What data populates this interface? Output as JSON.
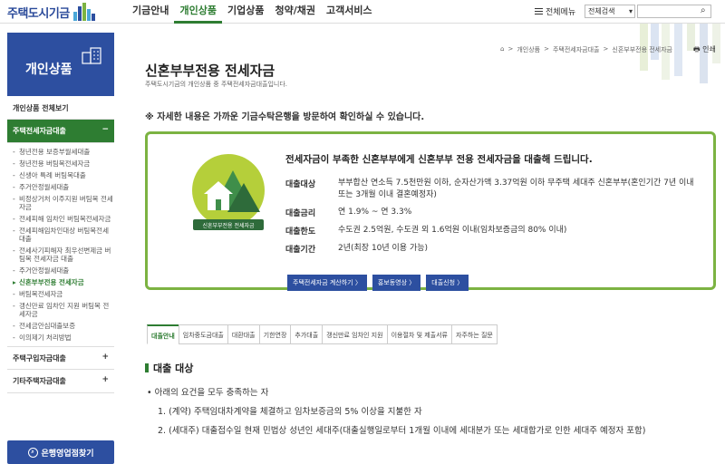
{
  "header": {
    "logo_text": "주택도시기금",
    "nav": [
      "기금안내",
      "개인상품",
      "기업상품",
      "청약/채권",
      "고객서비스"
    ],
    "sitemap_label": "전체메뉴",
    "search_select": "전체검색",
    "search_placeholder": ""
  },
  "sidebar": {
    "hero_title": "개인상품",
    "all_label": "개인상품 전체보기",
    "groups": [
      {
        "label": "주택전세자금대출",
        "toggle": "−"
      },
      {
        "label": "주택구입자금대출",
        "toggle": "+"
      },
      {
        "label": "기타주택자금대출",
        "toggle": "+"
      }
    ],
    "sub_items": [
      "청년전용 보증부월세대출",
      "청년전용 버팀목전세자금",
      "신생아 특례 버팀목대출",
      "주거안정월세대출",
      "비정상거처 이주지원 버팀목 전세자금",
      "전세피해 임차인 버팀목전세자금",
      "전세피해임차인대상 버팀목전세대출",
      "전세사기피해자 최우선변제금 버팀목 전세자금 대출",
      "주거안정월세대출",
      "신혼부부전용 전세자금",
      "버팀목전세자금",
      "갱신만료 임차인 지원 버팀목 전세자금",
      "전세금안심대출보증",
      "이의제기 처리방법"
    ],
    "bank_button": "은행영업점찾기"
  },
  "content": {
    "breadcrumb": [
      "⌂",
      ">",
      "개인상품",
      ">",
      "주택전세자금대출",
      ">",
      "신혼부부전용 전세자금"
    ],
    "print_label": "인쇄",
    "title": "신혼부부전용 전세자금",
    "desc": "주택도시기금의 개인상품 중 주택전세자금대출입니다.",
    "notice": "※ 자세한 내용은 가까운 기금수탁은행을 방문하여 확인하실 수 있습니다.",
    "summary": {
      "emblem_text": "신혼부부전용 전세자금",
      "headline": "전세자금이 부족한 신혼부부에게 신혼부부 전용 전세자금을 대출해 드립니다.",
      "rows": [
        {
          "k": "대출대상",
          "v": "부부합산 연소득 7.5천만원 이하, 순자산가액 3.37억원 이하 무주택 세대주 신혼부부(혼인기간 7년 이내 또는 3개월 이내 결혼예정자)"
        },
        {
          "k": "대출금리",
          "v": "연 1.9% ~ 연 3.3%"
        },
        {
          "k": "대출한도",
          "v": "수도권 2.5억원, 수도권 외 1.6억원 이내(임차보증금의 80% 이내)"
        },
        {
          "k": "대출기간",
          "v": "2년(최장 10년 이용 가능)"
        }
      ],
      "buttons": [
        "주택전세자금 계산하기 〉",
        "홍보동영상 〉",
        "대출신청 〉"
      ]
    },
    "tabs": [
      "대출안내",
      "임차중도금대출",
      "대환대출",
      "기한연장",
      "추가대출",
      "갱신만료 임차인 지원",
      "이용절차 및 제출서류",
      "자주하는 질문"
    ],
    "section_title": "대출 대상",
    "section_lines": [
      "• 아래의 요건을 모두 충족하는 자",
      "1. (계약) 주택임대차계약을 체결하고 임차보증금의 5% 이상을 지불한 자",
      "2. (세대주) 대출접수일 현재 민법상 성년인 세대주(대출실행일로부터 1개월 이내에 세대분가 또는 세대합가로 인한 세대주 예정자 포함)"
    ]
  },
  "colors": {
    "brand_blue": "#2d4fa0",
    "accent_green": "#2e7d32",
    "box_border": "#7cb342"
  }
}
